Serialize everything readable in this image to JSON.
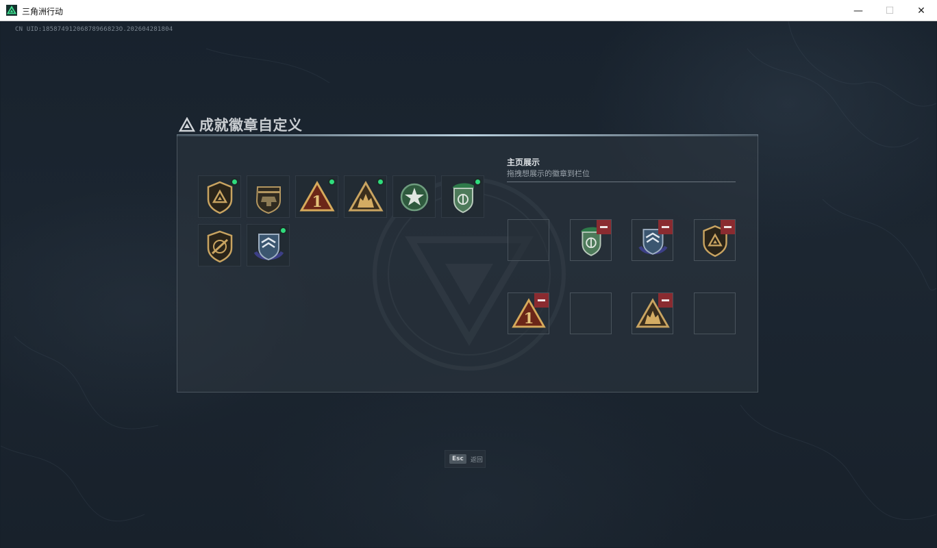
{
  "window": {
    "title": "三角洲行动",
    "minimize_glyph": "—",
    "maximize_glyph": "☐",
    "close_glyph": "✕"
  },
  "uid_text": "CN UID:18587491206878966823O.202604281804",
  "panel": {
    "title": "成就徽章自定义",
    "title_icon": "delta-triangle-icon"
  },
  "badges": [
    {
      "icon": "shield-delta-gold-icon",
      "new": true
    },
    {
      "icon": "helicopter-badge-icon",
      "new": false
    },
    {
      "icon": "triangle-number-one-icon",
      "new": true
    },
    {
      "icon": "triangle-soldiers-icon",
      "new": true
    },
    {
      "icon": "green-star-medal-icon",
      "new": false
    },
    {
      "icon": "green-beret-shield-icon",
      "new": true
    },
    {
      "icon": "rifle-shield-icon",
      "new": false
    },
    {
      "icon": "blue-wings-shield-icon",
      "new": true
    }
  ],
  "showcase": {
    "title": "主页展示",
    "subtitle": "拖拽想展示的徽章到栏位",
    "slots": [
      {
        "icon": null
      },
      {
        "icon": "green-beret-shield-icon"
      },
      {
        "icon": "blue-wings-shield-icon"
      },
      {
        "icon": "shield-delta-gold-icon"
      },
      {
        "icon": "triangle-number-one-icon"
      },
      {
        "icon": null
      },
      {
        "icon": "triangle-soldiers-icon"
      },
      {
        "icon": null
      }
    ]
  },
  "esc_hint": {
    "key": "Esc",
    "label": "返回"
  },
  "colors": {
    "new_dot": "#2fdc7d",
    "remove_button": "#8a2b30",
    "gold": "#c9a461",
    "background": "#18222d"
  }
}
